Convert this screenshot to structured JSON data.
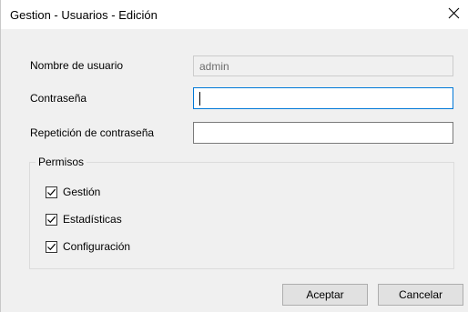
{
  "window": {
    "title": "Gestion - Usuarios - Edición",
    "close_icon": "close-icon"
  },
  "form": {
    "username_label": "Nombre de usuario",
    "username_value": "admin",
    "password_label": "Contraseña",
    "password_value": "",
    "repeat_label": "Repetición de contraseña",
    "repeat_value": ""
  },
  "permissions": {
    "legend": "Permisos",
    "items": [
      {
        "label": "Gestión",
        "checked": true
      },
      {
        "label": "Estadísticas",
        "checked": true
      },
      {
        "label": "Configuración",
        "checked": true
      }
    ]
  },
  "buttons": {
    "accept": "Aceptar",
    "cancel": "Cancelar"
  },
  "colors": {
    "focus_border": "#0078d7",
    "dialog_bg": "#f0f0f0"
  }
}
